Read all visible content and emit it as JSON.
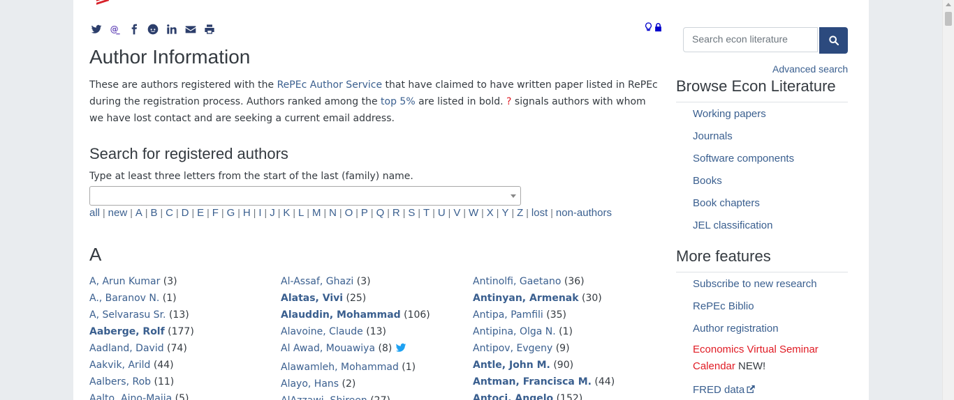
{
  "share": {
    "icons": [
      "twitter-icon",
      "mastodon-icon",
      "facebook-icon",
      "reddit-icon",
      "linkedin-icon",
      "email-icon",
      "print-icon"
    ]
  },
  "page": {
    "title": "Author Information",
    "intro": {
      "p1": "These are authors registered with the ",
      "link_author_service": "RePEc Author Service",
      "p2": " that have claimed to have written paper listed in RePEc during the registration process. Authors ranked among the ",
      "link_top5": "top 5%",
      "p3": " are listed in bold. ",
      "question_mark": "?",
      "p4": " signals authors with whom we have lost contact and are seeking a current email address."
    },
    "search_title": "Search for registered authors",
    "search_hint": "Type at least three letters from the start of the last (family) name.",
    "alpha_nav": [
      "all",
      "new",
      "A",
      "B",
      "C",
      "D",
      "E",
      "F",
      "G",
      "H",
      "I",
      "J",
      "K",
      "L",
      "M",
      "N",
      "O",
      "P",
      "Q",
      "R",
      "S",
      "T",
      "U",
      "V",
      "W",
      "X",
      "Y",
      "Z",
      "lost",
      "non-authors"
    ],
    "letter_heading": "A",
    "authors": {
      "col1": [
        {
          "name": "A, Arun Kumar",
          "count": "(3)",
          "bold": false
        },
        {
          "name": "A., Baranov N.",
          "count": "(1)",
          "bold": false
        },
        {
          "name": "A, Selvarasu Sr.",
          "count": "(13)",
          "bold": false
        },
        {
          "name": "Aaberge, Rolf",
          "count": "(177)",
          "bold": true
        },
        {
          "name": "Aadland, David",
          "count": "(74)",
          "bold": false
        },
        {
          "name": "Aakvik, Arild",
          "count": "(44)",
          "bold": false
        },
        {
          "name": "Aalbers, Rob",
          "count": "(11)",
          "bold": false
        },
        {
          "name": "Aalto, Aino-Maija",
          "count": "(5)",
          "bold": false
        }
      ],
      "col2": [
        {
          "name": "Al-Assaf, Ghazi",
          "count": "(3)",
          "bold": false
        },
        {
          "name": "Alatas, Vivi",
          "count": "(25)",
          "bold": true
        },
        {
          "name": "Alauddin, Mohammad",
          "count": "(106)",
          "bold": true
        },
        {
          "name": "Alavoine, Claude",
          "count": "(13)",
          "bold": false
        },
        {
          "name": "Al Awad, Mouawiya",
          "count": "(8)",
          "bold": false,
          "twitter": true
        },
        {
          "name": "Alawamleh, Mohammad",
          "count": "(1)",
          "bold": false
        },
        {
          "name": "Alayo, Hans",
          "count": "(2)",
          "bold": false
        },
        {
          "name": "AlAzzawi, Shireen",
          "count": "(27)",
          "bold": false
        }
      ],
      "col3": [
        {
          "name": "Antinolfi, Gaetano",
          "count": "(36)",
          "bold": false
        },
        {
          "name": "Antinyan, Armenak",
          "count": "(30)",
          "bold": true
        },
        {
          "name": "Antipa, Pamfili",
          "count": "(35)",
          "bold": false
        },
        {
          "name": "Antipina, Olga N.",
          "count": "(1)",
          "bold": false
        },
        {
          "name": "Antipov, Evgeny",
          "count": "(9)",
          "bold": false
        },
        {
          "name": "Antle, John M.",
          "count": "(90)",
          "bold": true
        },
        {
          "name": "Antman, Francisca M.",
          "count": "(44)",
          "bold": true
        },
        {
          "name": "Antoci, Angelo",
          "count": "(152)",
          "bold": true
        }
      ]
    }
  },
  "sidebar": {
    "search_placeholder": "Search econ literature",
    "advanced_search": "Advanced search",
    "browse_title": "Browse Econ Literature",
    "browse_items": [
      "Working papers",
      "Journals",
      "Software components",
      "Books",
      "Book chapters",
      "JEL classification"
    ],
    "more_title": "More features",
    "more_items": [
      "Subscribe to new research",
      "RePEc Biblio",
      "Author registration"
    ],
    "seminar_line1": "Economics Virtual Seminar",
    "seminar_line2": "Calendar",
    "new_badge": " NEW!",
    "fred": "FRED data"
  },
  "colors": {
    "link": "#3a5f8f",
    "accent_red": "#e01b24",
    "button": "#2c4a7e"
  }
}
